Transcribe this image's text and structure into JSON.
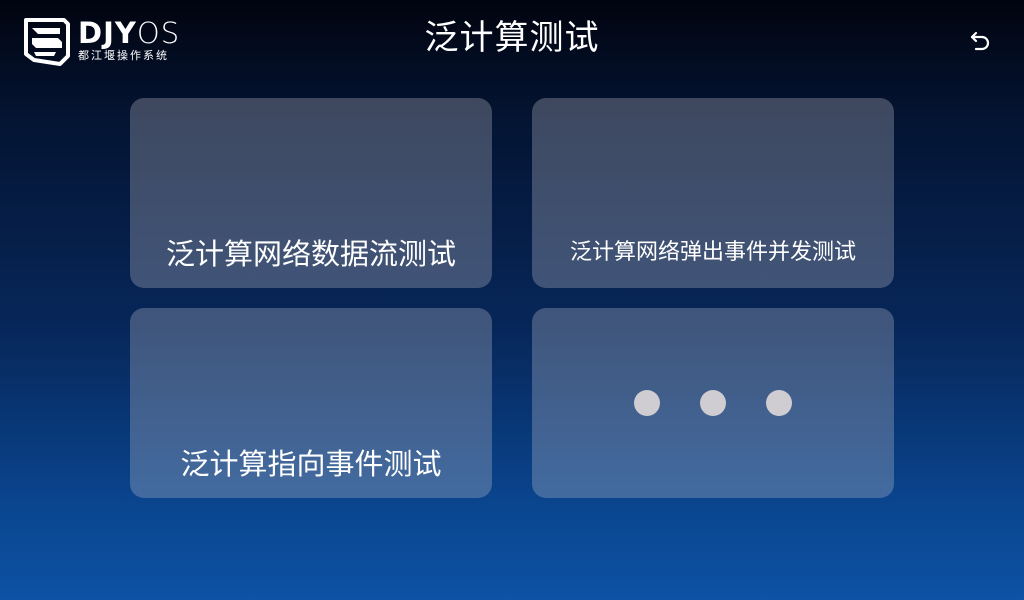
{
  "header": {
    "logo": {
      "brand_bold": "DJY",
      "brand_thin": "OS",
      "subtitle": "都江堰操作系统"
    },
    "title": "泛计算测试",
    "back_icon": "back-arrow-icon"
  },
  "cards": [
    {
      "label": "泛计算网络数据流测试"
    },
    {
      "label": "泛计算网络弹出事件并发测试"
    },
    {
      "label": "泛计算指向事件测试"
    },
    {
      "label": "",
      "icon": "more-dots-icon"
    }
  ],
  "colors": {
    "background_top": "#01040f",
    "background_bottom": "#0d52a4",
    "card": "rgba(200,200,210,0.30)",
    "dot": "#cfcdd2",
    "text": "#ffffff"
  }
}
